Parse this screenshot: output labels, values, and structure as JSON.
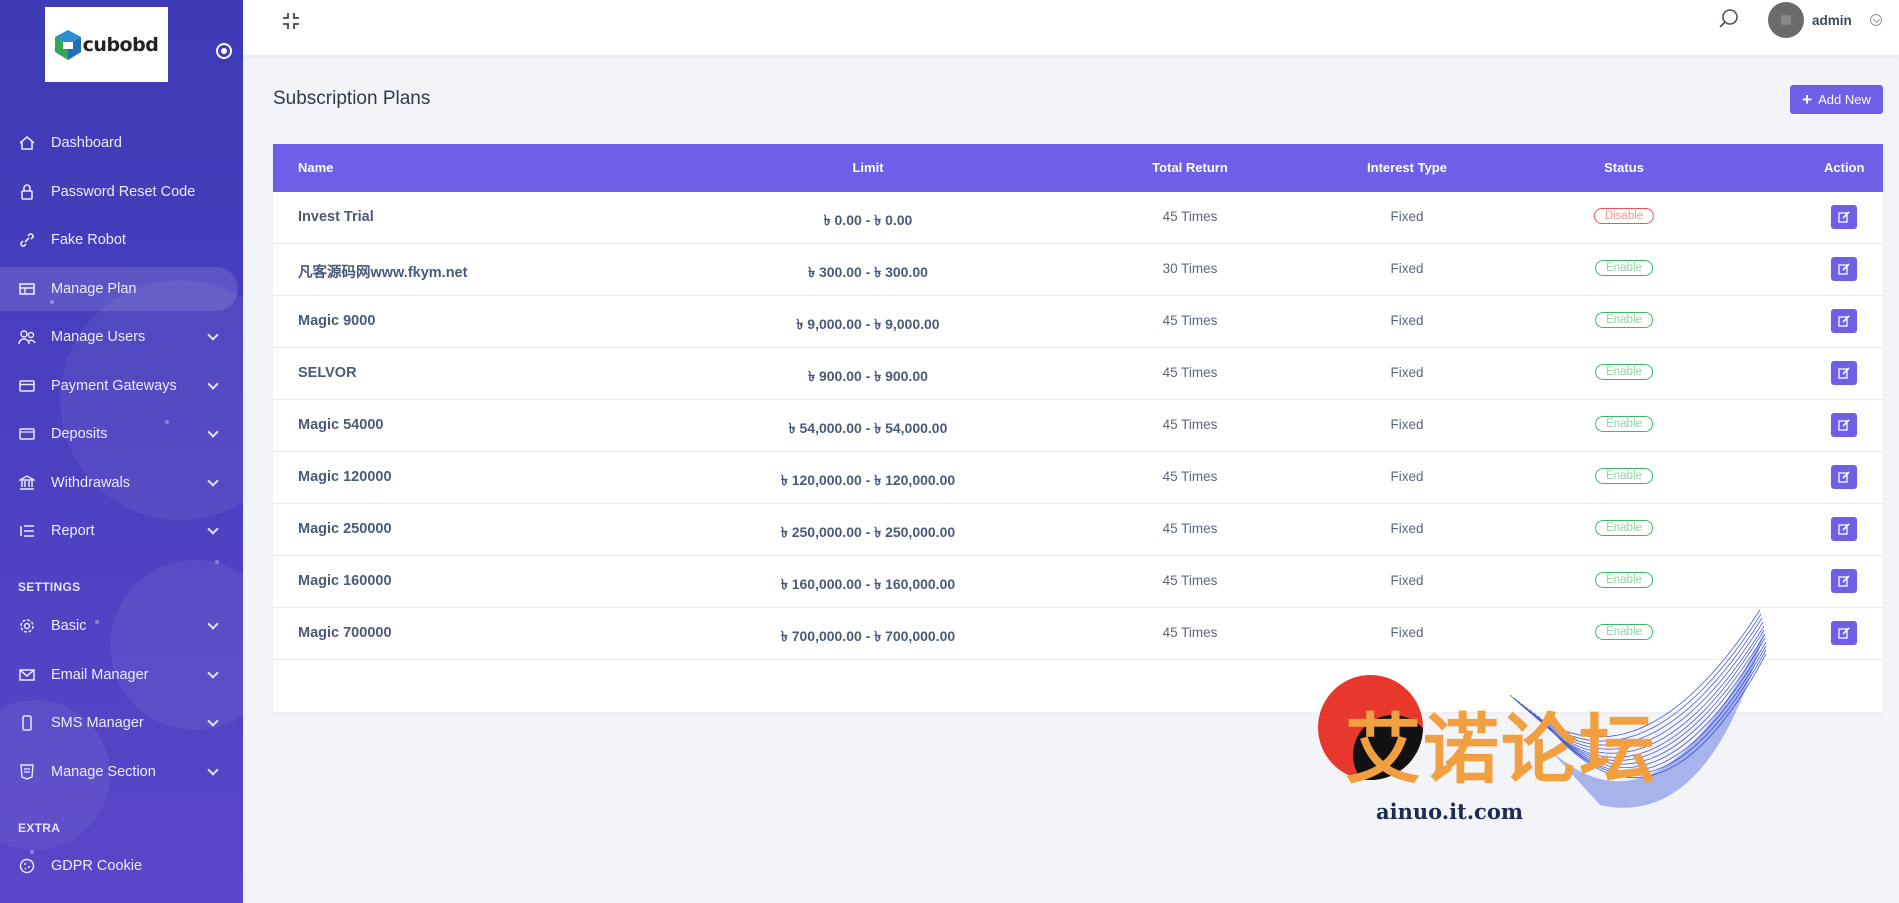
{
  "sidebar": {
    "logo_text": "cubobd",
    "items": [
      {
        "label": "Dashboard",
        "icon": "home-icon"
      },
      {
        "label": "Password Reset Code",
        "icon": "lock-icon"
      },
      {
        "label": "Fake Robot",
        "icon": "link-icon"
      },
      {
        "label": "Manage Plan",
        "icon": "plan-icon",
        "active": true
      },
      {
        "label": "Manage Users",
        "icon": "users-icon"
      },
      {
        "label": "Payment Gateways",
        "icon": "card-icon"
      },
      {
        "label": "Deposits",
        "icon": "wallet-icon"
      },
      {
        "label": "Withdrawals",
        "icon": "bank-icon"
      },
      {
        "label": "Report",
        "icon": "list-icon"
      }
    ],
    "settings_heading": "SETTINGS",
    "settings_items": [
      {
        "label": "Basic",
        "icon": "gear-icon"
      },
      {
        "label": "Email Manager",
        "icon": "mail-icon"
      },
      {
        "label": "SMS Manager",
        "icon": "mobile-icon"
      },
      {
        "label": "Manage Section",
        "icon": "html-icon"
      }
    ],
    "extra_heading": "EXTRA",
    "extra_items": [
      {
        "label": "GDPR Cookie",
        "icon": "cookie-icon"
      }
    ]
  },
  "topbar": {
    "user_name": "admin"
  },
  "main": {
    "title": "Subscription Plans",
    "add_label": "Add New",
    "columns": [
      "Name",
      "Limit",
      "Total Return",
      "Interest Type",
      "Status",
      "Action"
    ],
    "rows": [
      {
        "name": "Invest Trial",
        "limit": "৳ 0.00 - ৳ 0.00",
        "total_return": "45 Times",
        "interest_type": "Fixed",
        "status": "Disable"
      },
      {
        "name": "凡客源码网www.fkym.net",
        "limit": "৳ 300.00 - ৳ 300.00",
        "total_return": "30 Times",
        "interest_type": "Fixed",
        "status": "Enable"
      },
      {
        "name": "Magic 9000",
        "limit": "৳ 9,000.00 - ৳ 9,000.00",
        "total_return": "45 Times",
        "interest_type": "Fixed",
        "status": "Enable"
      },
      {
        "name": "SELVOR",
        "limit": "৳ 900.00 - ৳ 900.00",
        "total_return": "45 Times",
        "interest_type": "Fixed",
        "status": "Enable"
      },
      {
        "name": "Magic 54000",
        "limit": "৳ 54,000.00 - ৳ 54,000.00",
        "total_return": "45 Times",
        "interest_type": "Fixed",
        "status": "Enable"
      },
      {
        "name": "Magic 120000",
        "limit": "৳ 120,000.00 - ৳ 120,000.00",
        "total_return": "45 Times",
        "interest_type": "Fixed",
        "status": "Enable"
      },
      {
        "name": "Magic 250000",
        "limit": "৳ 250,000.00 - ৳ 250,000.00",
        "total_return": "45 Times",
        "interest_type": "Fixed",
        "status": "Enable"
      },
      {
        "name": "Magic 160000",
        "limit": "৳ 160,000.00 - ৳ 160,000.00",
        "total_return": "45 Times",
        "interest_type": "Fixed",
        "status": "Enable"
      },
      {
        "name": "Magic 700000",
        "limit": "৳ 700,000.00 - ৳ 700,000.00",
        "total_return": "45 Times",
        "interest_type": "Fixed",
        "status": "Enable"
      }
    ]
  },
  "watermark": {
    "title": "艾诺论坛",
    "subtitle": "ainuo.it.com"
  },
  "colors": {
    "accent": "#6f5ee6",
    "sidebar": "#4a3fc0",
    "enable": "#3fb868",
    "disable": "#e65757"
  }
}
